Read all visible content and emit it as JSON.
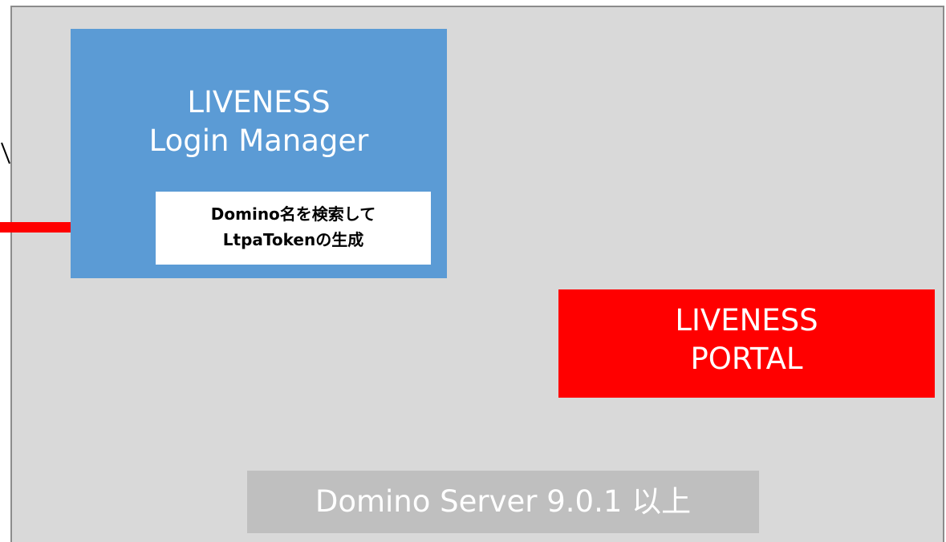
{
  "diagram": {
    "server": {
      "label": "Domino Server 9.0.1 以上",
      "color": "#d9d9d9"
    },
    "login_manager": {
      "title_line1": "LIVENESS",
      "title_line2": "Login Manager",
      "color": "#5b9bd5",
      "note_line1": "Domino名を検索して",
      "note_line2": "LtpaTokenの生成"
    },
    "portal": {
      "title_line1": "LIVENESS",
      "title_line2": "PORTAL",
      "color": "#ff0000"
    },
    "connector_color": "#ff0000"
  }
}
